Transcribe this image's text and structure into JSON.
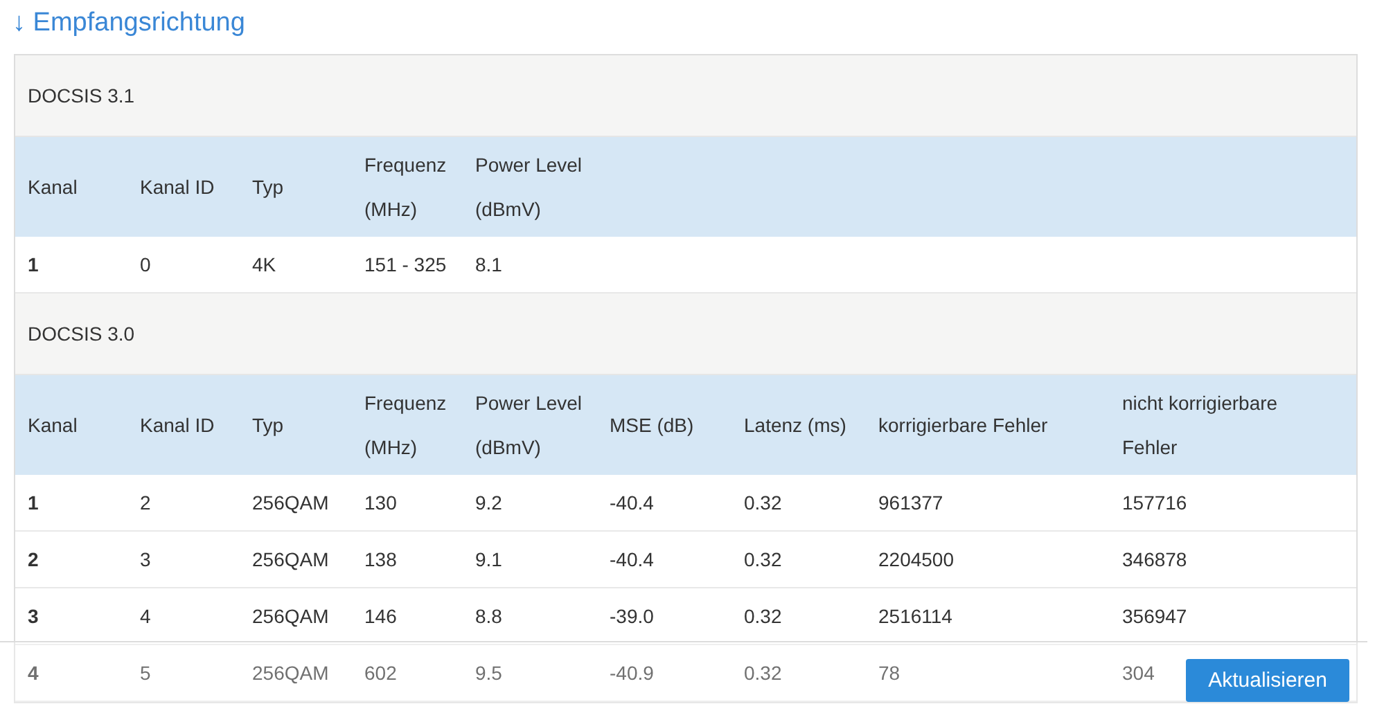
{
  "heading": {
    "arrow": "↓",
    "text": "Empfangsrichtung"
  },
  "sections": [
    {
      "title": "DOCSIS 3.1",
      "columns": [
        "Kanal",
        "Kanal ID",
        "Typ",
        "Frequenz (MHz)",
        "Power Level (dBmV)"
      ],
      "rows": [
        [
          "1",
          "0",
          "4K",
          "151 - 325",
          "8.1"
        ]
      ]
    },
    {
      "title": "DOCSIS 3.0",
      "columns": [
        "Kanal",
        "Kanal ID",
        "Typ",
        "Frequenz (MHz)",
        "Power Level (dBmV)",
        "MSE (dB)",
        "Latenz (ms)",
        "korrigierbare Fehler",
        "nicht korrigierbare Fehler"
      ],
      "rows": [
        [
          "1",
          "2",
          "256QAM",
          "130",
          "9.2",
          "-40.4",
          "0.32",
          "961377",
          "157716"
        ],
        [
          "2",
          "3",
          "256QAM",
          "138",
          "9.1",
          "-40.4",
          "0.32",
          "2204500",
          "346878"
        ],
        [
          "3",
          "4",
          "256QAM",
          "146",
          "8.8",
          "-39.0",
          "0.32",
          "2516114",
          "356947"
        ],
        [
          "4",
          "5",
          "256QAM",
          "602",
          "9.5",
          "-40.9",
          "0.32",
          "78",
          "304"
        ]
      ]
    }
  ],
  "button": "Aktualisieren"
}
